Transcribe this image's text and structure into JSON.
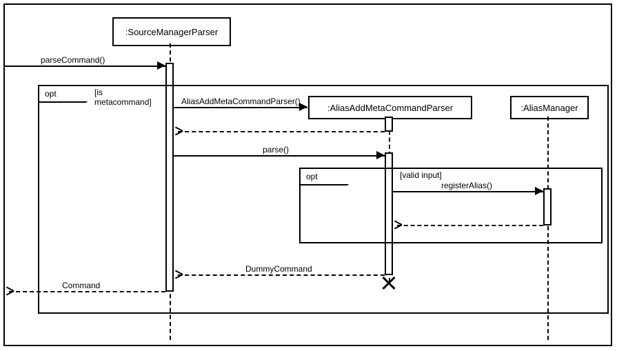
{
  "chart_data": {
    "type": "uml_sequence_diagram",
    "participants": [
      {
        "id": "smp",
        "name": ":SourceManagerParser",
        "pre_existing": true
      },
      {
        "id": "aamcp",
        "name": ":AliasAddMetaCommandParser",
        "pre_existing": false,
        "created_by_msg": "m_createParser"
      },
      {
        "id": "am",
        "name": ":AliasManager",
        "pre_existing": true
      }
    ],
    "messages": [
      {
        "id": "m_parseCommand",
        "label": "parseCommand()",
        "from": "actor",
        "to": "smp",
        "kind": "sync"
      },
      {
        "id": "m_createParser",
        "label": "AliasAddMetaCommandParser()",
        "from": "smp",
        "to": "aamcp",
        "kind": "create"
      },
      {
        "id": "m_createReturn",
        "label": "",
        "from": "aamcp",
        "to": "smp",
        "kind": "return"
      },
      {
        "id": "m_parse",
        "label": "parse()",
        "from": "smp",
        "to": "aamcp",
        "kind": "sync"
      },
      {
        "id": "m_registerAlias",
        "label": "registerAlias()",
        "from": "aamcp",
        "to": "am",
        "kind": "sync"
      },
      {
        "id": "m_registerReturn",
        "label": "",
        "from": "am",
        "to": "aamcp",
        "kind": "return"
      },
      {
        "id": "m_dummy",
        "label": "DummyCommand",
        "from": "aamcp",
        "to": "smp",
        "kind": "return"
      },
      {
        "id": "m_command",
        "label": "Command",
        "from": "smp",
        "to": "actor",
        "kind": "return"
      }
    ],
    "fragments": [
      {
        "type": "opt",
        "id": "opt_outer",
        "guard": "[is metacommand]",
        "contains": [
          "m_createParser",
          "m_createReturn",
          "m_parse",
          "m_registerAlias",
          "m_registerReturn",
          "m_dummy",
          "m_command",
          "opt_inner"
        ]
      },
      {
        "type": "opt",
        "id": "opt_inner",
        "guard": "[valid input]",
        "contains": [
          "m_registerAlias",
          "m_registerReturn"
        ]
      }
    ],
    "destructions": [
      {
        "participant": "aamcp",
        "after_msg": "m_dummy"
      }
    ]
  },
  "labels": {
    "opt_tag": "opt",
    "smp_head": ":SourceManagerParser",
    "aamcp_head": ":AliasAddMetaCommandParser",
    "am_head": ":AliasManager",
    "guard_outer": "[is metacommand]",
    "guard_inner": "[valid input]",
    "parseCommand": "parseCommand()",
    "createParser": "AliasAddMetaCommandParser()",
    "parse": "parse()",
    "registerAlias": "registerAlias()",
    "dummy": "DummyCommand",
    "command": "Command"
  }
}
